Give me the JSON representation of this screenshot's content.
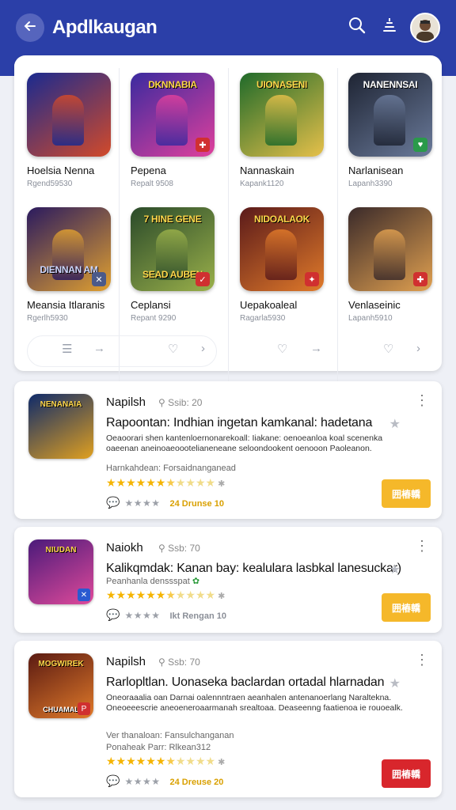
{
  "header": {
    "title": "Apdlkaugan",
    "back_icon": "back-arrow-icon",
    "search_icon": "search-icon",
    "sort_icon": "sort-icon",
    "avatar": "user-avatar",
    "background": "#2b3fa8"
  },
  "grid": {
    "tiles": [
      {
        "art_text": "",
        "name": "Hoelsia Nenna",
        "sub": "Rgend59530",
        "colors": [
          "#1a2a8f",
          "#d24a2a"
        ],
        "badge": ""
      },
      {
        "art_text": "DKNNABIA",
        "name": "Pepena",
        "sub": "Repalt 9508",
        "colors": [
          "#3a2a9f",
          "#e0409c"
        ],
        "badge": "✚",
        "badge_color": "#d03030"
      },
      {
        "art_text": "UIONASENI",
        "name": "Nannaskain",
        "sub": "Kapank1120",
        "colors": [
          "#1f6a2a",
          "#e6c04a"
        ],
        "badge": ""
      },
      {
        "art_text": "NANENNSAI",
        "name": "Narlanisean",
        "sub": "Lapanh3390",
        "colors": [
          "#1e2433",
          "#6a7a9a"
        ],
        "badge": "♥",
        "badge_color": "#2a9a4a"
      },
      {
        "art_text": "",
        "name": "Meansia Itlaranis",
        "sub": "Rgerlh5930",
        "colors": [
          "#2a1a5f",
          "#e0a030"
        ],
        "badge": "✕",
        "badge_color": "#4a5a8a",
        "bottom_text": "DIENNAN AM"
      },
      {
        "art_text": "7 HINE GENE",
        "name": "Ceplansi",
        "sub": "Repant 9290",
        "colors": [
          "#2a4a2a",
          "#9ab04a"
        ],
        "badge": "✓",
        "badge_color": "#d03030",
        "bottom_text": "SEAD AUBEN"
      },
      {
        "art_text": "NIDOALAOK",
        "name": "Uepakoaleal",
        "sub": "Ragarla5930",
        "colors": [
          "#5a1a1a",
          "#e07a2a"
        ],
        "badge": "✦",
        "badge_color": "#d03030"
      },
      {
        "art_text": "",
        "name": "Venlaseinic",
        "sub": "Lapanh5910",
        "colors": [
          "#3a2a2a",
          "#e0a050"
        ],
        "badge": "✚",
        "badge_color": "#d03030"
      }
    ],
    "actions_left": [
      "☰",
      "→",
      "♡",
      "›"
    ],
    "actions_right": [
      "♡",
      "→",
      "♡",
      "›"
    ]
  },
  "list": [
    {
      "name": "Napilsh",
      "meta": "Ssib: 20",
      "title": "Rapoontan: Indhian ingetan kamkanal: hadetana",
      "desc": "Oeaoorari shen kantenloernonarekoall: Iiakane: oenoeanloa koal scenenka oaeenan aneinoaeoootelianeneane seloondookent oenooon Paoleanon.",
      "developer": "Harnkahdean: Forsaidnanganead",
      "developer2": "",
      "extra": "24 Drunse 10",
      "install": "囲樁轎",
      "install_color": "#f5b82a",
      "extra_color": "#d9a000",
      "thumb_top": "NENANAIA",
      "thumb_bottom": "",
      "thumb_colors": [
        "#0e2a6a",
        "#e0a020"
      ],
      "thumb_badge": ""
    },
    {
      "name": "Naiokh",
      "meta": "Ssb: 70",
      "title": "Kalikqmdak: Kanan bay: kealulara lasbkal lanesuckar)",
      "desc": "",
      "developer": "Peanhanla denssspat",
      "developer2": "",
      "extra": "Ikt Rengan 10",
      "install": "囲樁轎",
      "install_color": "#f5b82a",
      "extra_color": "#8b8f98",
      "thumb_top": "NIUDAN",
      "thumb_bottom": "",
      "thumb_colors": [
        "#4a1a7a",
        "#e04a9a"
      ],
      "thumb_badge": "✕",
      "thumb_badge_color": "#2a5ad0"
    },
    {
      "name": "Napilsh",
      "meta": "Ssb: 70",
      "title": "Rarlopltlan. Uonaseka baclardan ortadal hlarnadan",
      "desc": "Oneoraaalia oan Darnai oalennntraen aeanhalen antenanoerlang Naraltekna. Oneoeeescrie aneoeneroaarmanah srealtoaa. Deaseenng faatienoa ie rouoealk.",
      "developer": "Ver thanaloan: Fansulchanganan",
      "developer2": "Ponaheak Parr: Rlkean312",
      "extra": "24 Dreuse 20",
      "install": "囲樁轎",
      "install_color": "#d8262c",
      "extra_color": "#d9a000",
      "thumb_top": "MOGWIREK",
      "thumb_bottom": "CHUAMAL",
      "thumb_colors": [
        "#5a1a12",
        "#e07a2a"
      ],
      "thumb_badge": "P",
      "thumb_badge_color": "#d03030"
    }
  ]
}
